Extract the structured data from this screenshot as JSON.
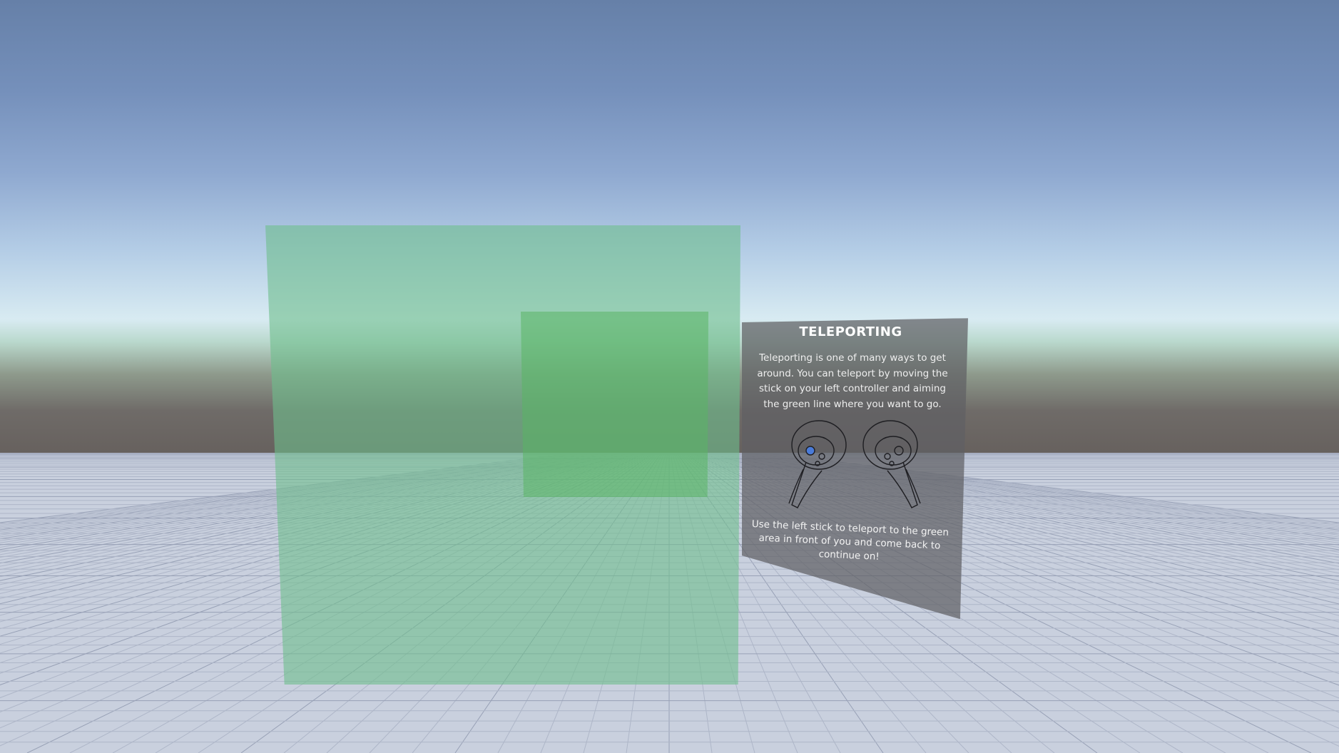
{
  "scene": {
    "type": "vr-tutorial-environment",
    "colors": {
      "sky_top": "#6680a8",
      "horizon": "#d8ebf2",
      "ground_band": "#66605d",
      "floor": "#c9d0de",
      "grid_line": "#aab2c4",
      "teleport_area": "#6ebe8c",
      "panel_bg": "#5f5f64",
      "stick_highlight": "#4a7bd8"
    }
  },
  "info_panel": {
    "title": "TELEPORTING",
    "body": "Teleporting is one of many ways to get around. You can teleport by moving the stick on your left controller and aiming the green line where you want to go.",
    "footer": "Use the left stick to teleport to the green area in front of you and come back to continue on!",
    "image": {
      "left_controller_icon": "left-controller-icon",
      "right_controller_icon": "right-controller-icon"
    }
  }
}
